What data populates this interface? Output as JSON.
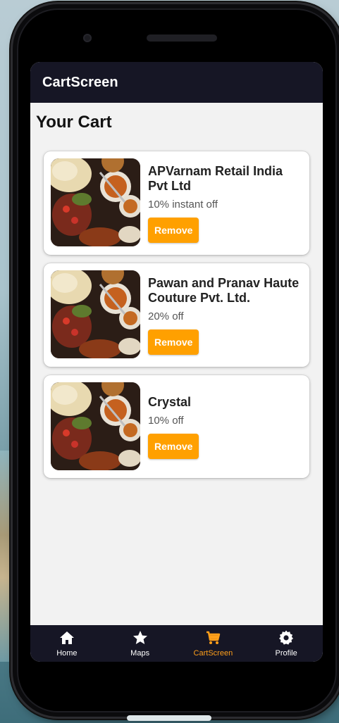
{
  "appbar": {
    "title": "CartScreen"
  },
  "page": {
    "heading": "Your Cart"
  },
  "cart": {
    "items": [
      {
        "name_line1": "APVarnam Retail India",
        "name_line2": "Pvt Ltd",
        "offer": "10% instant off",
        "remove_label": "Remove"
      },
      {
        "name_line1": "Pawan and Pranav Haute",
        "name_line2": "Couture Pvt. Ltd.",
        "offer": "20% off",
        "remove_label": "Remove"
      },
      {
        "name_line1": "Crystal",
        "name_line2": "",
        "offer": "10% off",
        "remove_label": "Remove"
      }
    ]
  },
  "nav": {
    "items": [
      {
        "label": "Home",
        "icon": "home-icon"
      },
      {
        "label": "Maps",
        "icon": "star-icon"
      },
      {
        "label": "CartScreen",
        "icon": "cart-icon",
        "active": true
      },
      {
        "label": "Profile",
        "icon": "gear-icon"
      }
    ]
  },
  "colors": {
    "accent": "#ffa000",
    "appbar": "#161625",
    "screen_bg": "#f2f2f2"
  }
}
